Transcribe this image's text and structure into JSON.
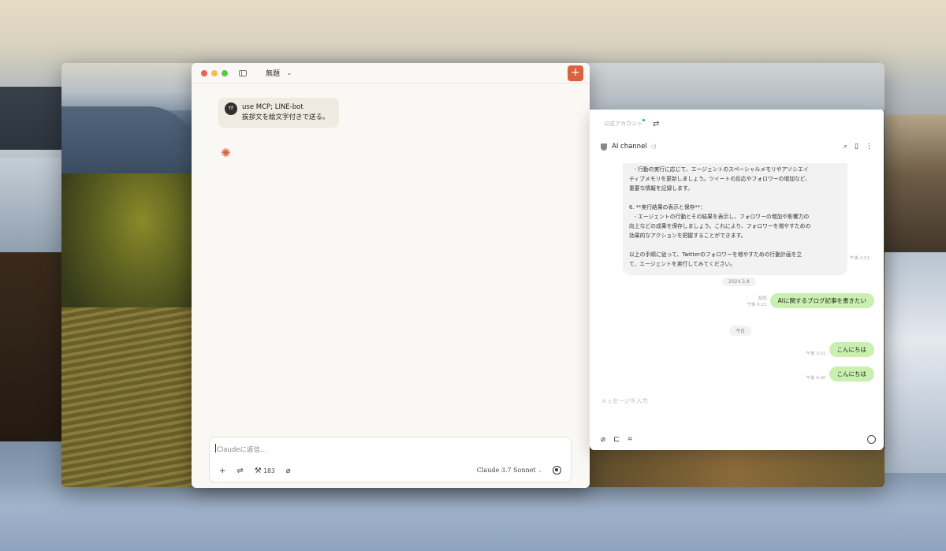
{
  "claude": {
    "title": "無題",
    "new_chat_label": "+",
    "user_message": {
      "avatar_initials": "YF",
      "line1": "use MCP; LINE-bot",
      "line2": "挨拶文を絵文字付きで送る。"
    },
    "composer": {
      "placeholder": "Claudeに返信...",
      "tools_count": "183",
      "model": "Claude 3.7 Sonnet"
    }
  },
  "line": {
    "top_tab": "公式アカウント",
    "channel_name": "AI channel",
    "bot_message": "   - 行動の実行に応じて、エージェントのスペーシャルメモリやアソシエイ\nティブメモリを更新しましょう。ツイートの反応やフォロワーの増加など、\n重要な情報を記録します。\n\n6. **実行結果の表示と保存**：\n   - エージェントの行動とその結果を表示し、フォロワーの増加や影響力の\n向上などの成果を保存しましょう。これにより、フォロワーを増やすための\n効果的なアクションを把握することができます。\n\n以上の手順に従って、Twitterのフォロワーを増やすための行動計画を立\nて、エージェントを実行してみてください。",
    "bot_time": "午後 2:51",
    "date1": "2024.3.8",
    "msg1": {
      "meta1": "既読",
      "meta2": "午後 6:22",
      "text": "AIに関するブログ記事を書きたい"
    },
    "date2": "今日",
    "msg2": {
      "meta": "午後 3:01",
      "text": "こんにちは"
    },
    "msg3": {
      "meta": "午後 4:00",
      "text": "こんにちは"
    },
    "input_placeholder": "メッセージを入力"
  }
}
